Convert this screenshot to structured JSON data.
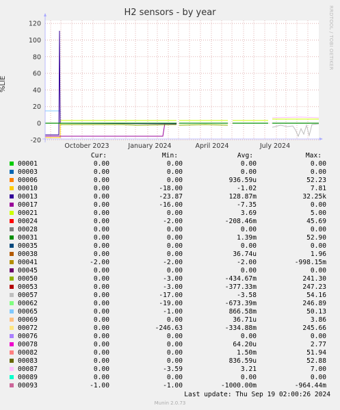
{
  "chart_data": {
    "type": "line",
    "title": "H2 sensors - by year",
    "ylabel": "%LIE",
    "ylim": [
      -20,
      125
    ],
    "yticks": [
      -20,
      0,
      20,
      40,
      60,
      80,
      100,
      120
    ],
    "xtick_labels": [
      "October 2023",
      "January 2024",
      "April 2024",
      "July 2024"
    ],
    "grid": true
  },
  "side_text": "RRDTOOL / TOBI OETIKER",
  "legend_headers": {
    "cur": "Cur:",
    "min": "Min:",
    "avg": "Avg:",
    "max": "Max:"
  },
  "series": [
    {
      "name": "00001",
      "color": "#00cc00",
      "cur": "0.00",
      "min": "0.00",
      "avg": "0.00",
      "max": "0.00"
    },
    {
      "name": "00003",
      "color": "#0066b3",
      "cur": "0.00",
      "min": "0.00",
      "avg": "0.00",
      "max": "0.00"
    },
    {
      "name": "00006",
      "color": "#ff8000",
      "cur": "0.00",
      "min": "0.00",
      "avg": "936.59u",
      "max": "52.23"
    },
    {
      "name": "00010",
      "color": "#ffcc00",
      "cur": "0.00",
      "min": "-18.00",
      "avg": "-1.02",
      "max": "7.81"
    },
    {
      "name": "00013",
      "color": "#330099",
      "cur": "0.00",
      "min": "-23.87",
      "avg": "128.87m",
      "max": "32.25k"
    },
    {
      "name": "00017",
      "color": "#990099",
      "cur": "0.00",
      "min": "-16.00",
      "avg": "-7.35",
      "max": "0.00"
    },
    {
      "name": "00021",
      "color": "#ccff00",
      "cur": "0.00",
      "min": "0.00",
      "avg": "3.69",
      "max": "5.00"
    },
    {
      "name": "00024",
      "color": "#ff0000",
      "cur": "0.00",
      "min": "-2.00",
      "avg": "-208.46m",
      "max": "45.69"
    },
    {
      "name": "00028",
      "color": "#808080",
      "cur": "0.00",
      "min": "0.00",
      "avg": "0.00",
      "max": "0.00"
    },
    {
      "name": "00031",
      "color": "#008f00",
      "cur": "0.00",
      "min": "0.00",
      "avg": "1.39m",
      "max": "52.90"
    },
    {
      "name": "00035",
      "color": "#00487d",
      "cur": "0.00",
      "min": "0.00",
      "avg": "0.00",
      "max": "0.00"
    },
    {
      "name": "00038",
      "color": "#b35a00",
      "cur": "0.00",
      "min": "0.00",
      "avg": "36.74u",
      "max": "1.96"
    },
    {
      "name": "00041",
      "color": "#b38f00",
      "cur": "-2.00",
      "min": "-2.00",
      "avg": "-2.00",
      "max": "-998.15m"
    },
    {
      "name": "00045",
      "color": "#6b006b",
      "cur": "0.00",
      "min": "0.00",
      "avg": "0.00",
      "max": "0.00"
    },
    {
      "name": "00050",
      "color": "#8fb300",
      "cur": "0.00",
      "min": "-3.00",
      "avg": "-434.67m",
      "max": "241.30"
    },
    {
      "name": "00053",
      "color": "#b30000",
      "cur": "0.00",
      "min": "-3.00",
      "avg": "-377.33m",
      "max": "247.23"
    },
    {
      "name": "00057",
      "color": "#bebebe",
      "cur": "0.00",
      "min": "-17.00",
      "avg": "-3.58",
      "max": "54.16"
    },
    {
      "name": "00062",
      "color": "#80ff80",
      "cur": "0.00",
      "min": "-19.00",
      "avg": "-673.39m",
      "max": "246.89"
    },
    {
      "name": "00065",
      "color": "#80c9ff",
      "cur": "0.00",
      "min": "-1.00",
      "avg": "866.58m",
      "max": "50.13"
    },
    {
      "name": "00069",
      "color": "#ffc080",
      "cur": "0.00",
      "min": "0.00",
      "avg": "36.71u",
      "max": "3.86"
    },
    {
      "name": "00072",
      "color": "#ffe680",
      "cur": "0.00",
      "min": "-246.63",
      "avg": "-334.88m",
      "max": "245.66"
    },
    {
      "name": "00076",
      "color": "#aa80ff",
      "cur": "0.00",
      "min": "0.00",
      "avg": "0.00",
      "max": "0.00"
    },
    {
      "name": "00078",
      "color": "#ee00cc",
      "cur": "0.00",
      "min": "0.00",
      "avg": "64.20u",
      "max": "2.77"
    },
    {
      "name": "00082",
      "color": "#ff8080",
      "cur": "0.00",
      "min": "0.00",
      "avg": "1.50m",
      "max": "51.94"
    },
    {
      "name": "00083",
      "color": "#666600",
      "cur": "0.00",
      "min": "0.00",
      "avg": "836.59u",
      "max": "52.88"
    },
    {
      "name": "00087",
      "color": "#ffbfff",
      "cur": "0.00",
      "min": "-3.59",
      "avg": "3.21",
      "max": "7.00"
    },
    {
      "name": "00089",
      "color": "#00ffcc",
      "cur": "0.00",
      "min": "0.00",
      "avg": "0.00",
      "max": "0.00"
    },
    {
      "name": "00093",
      "color": "#cc6699",
      "cur": "-1.00",
      "min": "-1.00",
      "avg": "-1000.00m",
      "max": "-964.44m"
    }
  ],
  "last_update": "Last update: Thu Sep 19 02:00:26 2024",
  "footer": "Munin 2.0.73"
}
